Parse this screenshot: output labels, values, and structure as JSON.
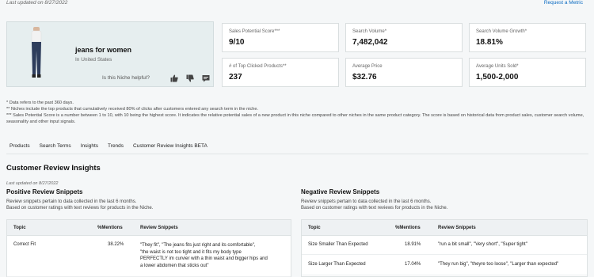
{
  "header": {
    "last_updated": "Last updated on 8/27/2022",
    "request_metric": "Request a Metric"
  },
  "product": {
    "title": "jeans for women",
    "location": "In United States",
    "helpful_question": "Is this Niche helpful?"
  },
  "metrics": [
    {
      "label": "Sales Potential Score***",
      "value": "9/10"
    },
    {
      "label": "Search Volume*",
      "value": "7,482,042"
    },
    {
      "label": "Search Volume Growth*",
      "value": "18.81%"
    },
    {
      "label": "# of Top Clicked Products**",
      "value": "237"
    },
    {
      "label": "Average Price",
      "value": "$32.76"
    },
    {
      "label": "Average Units Sold*",
      "value": "1,500-2,000"
    }
  ],
  "notes": [
    "* Data refers to the past 360 days.",
    "** Niches include the top products that cumulatively received 80% of clicks after customers entered any search term in the niche.",
    "*** Sales Potential Score is a number between 1 to 10, with 10 being the highest score. It indicates the relative potential sales of a new product in this niche compared to other niches in the same product category. The score is based on historical data from product sales, customer search volume, seasonality and other input signals."
  ],
  "tabs": [
    "Products",
    "Search Terms",
    "Insights",
    "Trends",
    "Customer Review Insights BETA"
  ],
  "review_section": {
    "title": "Customer Review Insights",
    "last_updated": "Last updated on 8/27/2022"
  },
  "positive": {
    "title": "Positive Review Snippets",
    "note1": "Review snippets pertain to data collected in the last 6 months.",
    "note2": "Based on customer ratings with text reviews for products in the Niche.",
    "headers": {
      "topic": "Topic",
      "mentions": "%Mentions",
      "snippets": "Review Snippets"
    },
    "rows": [
      {
        "topic": "Correct Fit",
        "mentions": "38.22%",
        "snippet_lines": [
          "\"They fit\", \"The jeans fits just right and its comfortable\",",
          "\"the waist is not too tight and it fits my body type",
          "PERFECTLY im curvier with a thin waist and bigger hips and",
          "a lower abdomen that sticks out\""
        ]
      }
    ]
  },
  "negative": {
    "title": "Negative Review Snippets",
    "note1": "Review snippets pertain to data collected in the last 6 months.",
    "note2": "Based on customer ratings with text reviews for products in the Niche.",
    "headers": {
      "topic": "Topic",
      "mentions": "%Mentions",
      "snippets": "Review Snippets"
    },
    "rows": [
      {
        "topic": "Size Smaller Than Expected",
        "mentions": "18.91%",
        "snippet": "\"run a bit small\", \"Very short\", \"Super tight\""
      },
      {
        "topic": "Size Larger Than Expected",
        "mentions": "17.04%",
        "snippet": "\"They run big\", \"theyre too loose\", \"Larger than expected\""
      }
    ]
  },
  "colors": {
    "accent": "#1a8aa8",
    "link": "#0a6bc2",
    "card_bg": "#e6eeef"
  },
  "icons": [
    "thumbs-up-icon",
    "thumbs-down-icon",
    "comment-icon"
  ]
}
